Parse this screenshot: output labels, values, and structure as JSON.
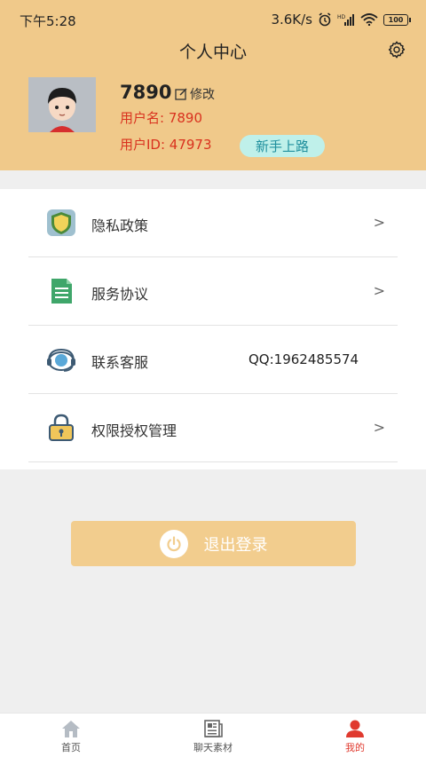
{
  "status_bar": {
    "time": "下午5:28",
    "speed": "3.6K/s",
    "battery": "100"
  },
  "header": {
    "title": "个人中心"
  },
  "profile": {
    "display_name": "7890",
    "edit_label": "修改",
    "username_line": "用户名: 7890",
    "userid_line": "用户ID: 47973",
    "guide_label": "新手上路"
  },
  "menu": {
    "items": [
      {
        "label": "隐私政策",
        "icon": "shield-icon",
        "arrow": ">"
      },
      {
        "label": "服务协议",
        "icon": "document-icon",
        "arrow": ">"
      },
      {
        "label": "联系客服",
        "icon": "customer-service-icon",
        "value": "QQ:1962485574"
      },
      {
        "label": "权限授权管理",
        "icon": "lock-icon",
        "arrow": ">"
      }
    ]
  },
  "logout_label": "退出登录",
  "tabs": [
    {
      "label": "首页",
      "icon": "home-icon"
    },
    {
      "label": "聊天素材",
      "icon": "newspaper-icon"
    },
    {
      "label": "我的",
      "icon": "person-icon",
      "active": true
    }
  ],
  "colors": {
    "header_bg": "#f0c98a",
    "accent_red": "#d9321f",
    "logout_bg": "#f2cd8e"
  }
}
